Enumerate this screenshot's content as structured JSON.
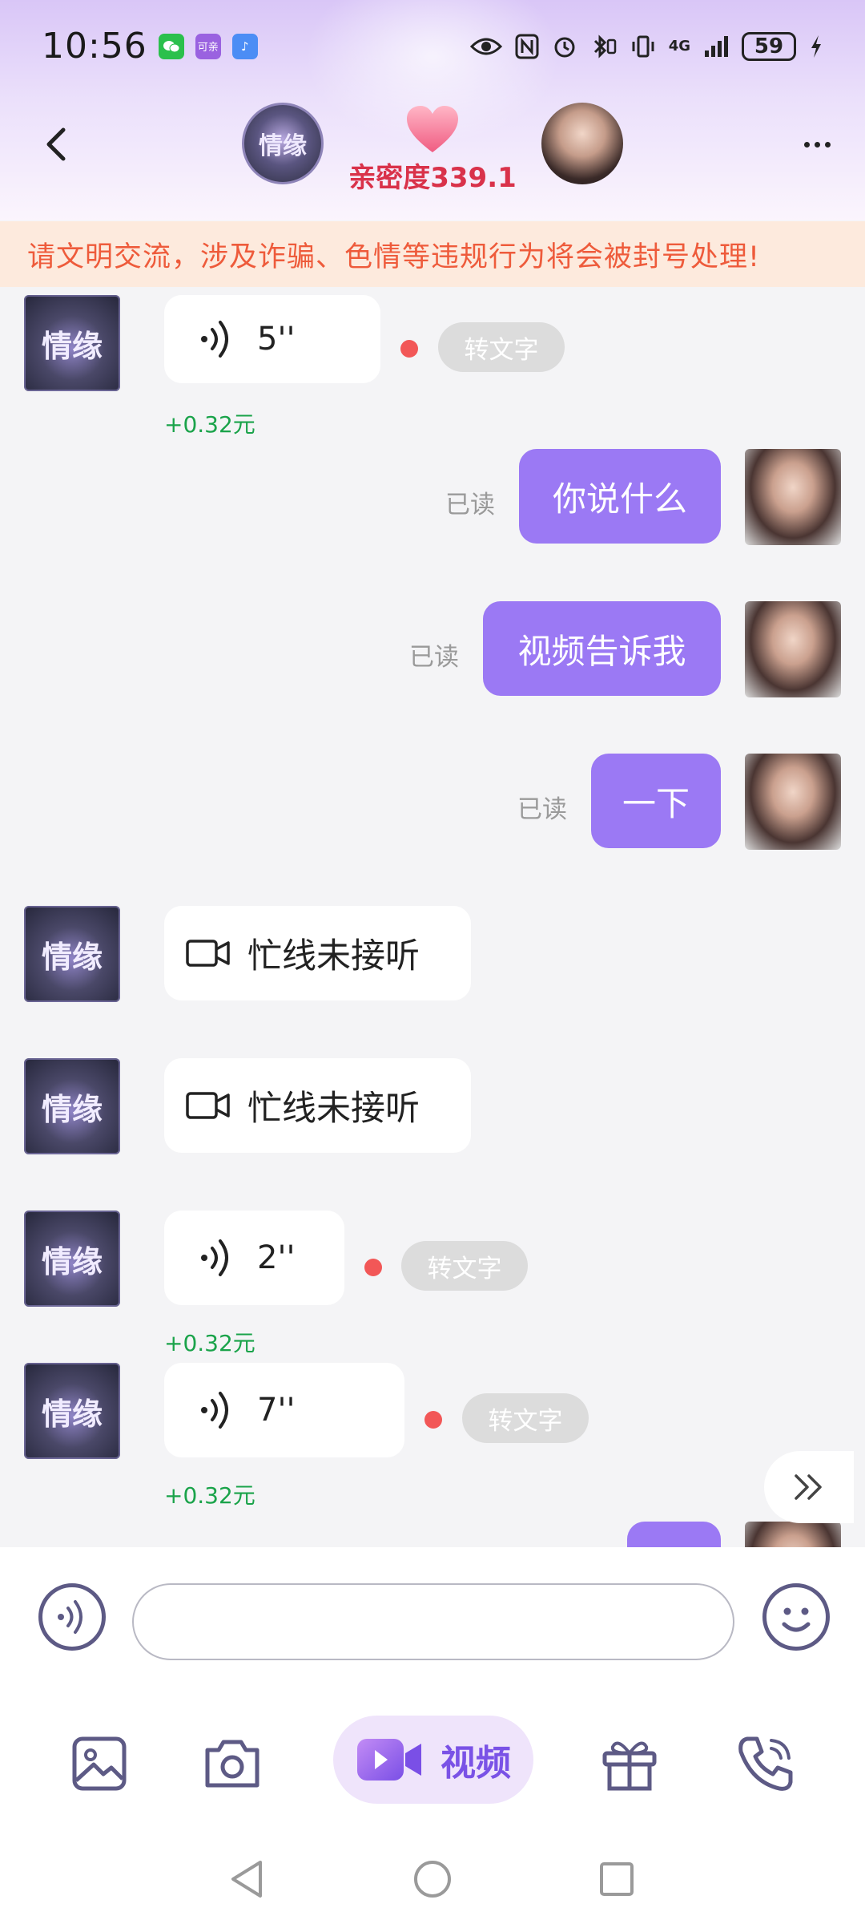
{
  "status_bar": {
    "time": "10:56",
    "app_badge_2": "可亲",
    "network": "4G",
    "battery": "59"
  },
  "header": {
    "left_avatar_text": "情缘",
    "intimacy": "亲密度339.1",
    "heart_color": "#f47a96"
  },
  "notice": {
    "text": "请文明交流，涉及诈骗、色情等违规行为将会被封号处理!"
  },
  "messages": {
    "m1": {
      "avatar_text": "情缘",
      "voice_len": "5''",
      "to_text": "转文字",
      "earn": "+0.32元"
    },
    "m2": {
      "text": "你说什么",
      "read": "已读"
    },
    "m3": {
      "text": "视频告诉我",
      "read": "已读"
    },
    "m4": {
      "text": "一下",
      "read": "已读"
    },
    "m5": {
      "avatar_text": "情缘",
      "text": "忙线未接听"
    },
    "m6": {
      "avatar_text": "情缘",
      "text": "忙线未接听"
    },
    "m7": {
      "avatar_text": "情缘",
      "voice_len": "2''",
      "to_text": "转文字",
      "earn": "+0.32元"
    },
    "m8": {
      "avatar_text": "情缘",
      "voice_len": "7''",
      "to_text": "转文字",
      "earn": "+0.32元"
    }
  },
  "input": {
    "placeholder": ""
  },
  "toolbar": {
    "video_label": "视频"
  },
  "colors": {
    "accent": "#9b79f4",
    "notice_text": "#ee5b3b",
    "earn_green": "#1aa34a",
    "intimacy_red": "#d9324a"
  },
  "icons": [
    "back-icon",
    "more-icon",
    "voice-icon",
    "video-camera-icon",
    "emoji-icon",
    "image-icon",
    "camera-icon",
    "gift-icon",
    "phone-icon",
    "double-chevron-icon"
  ]
}
